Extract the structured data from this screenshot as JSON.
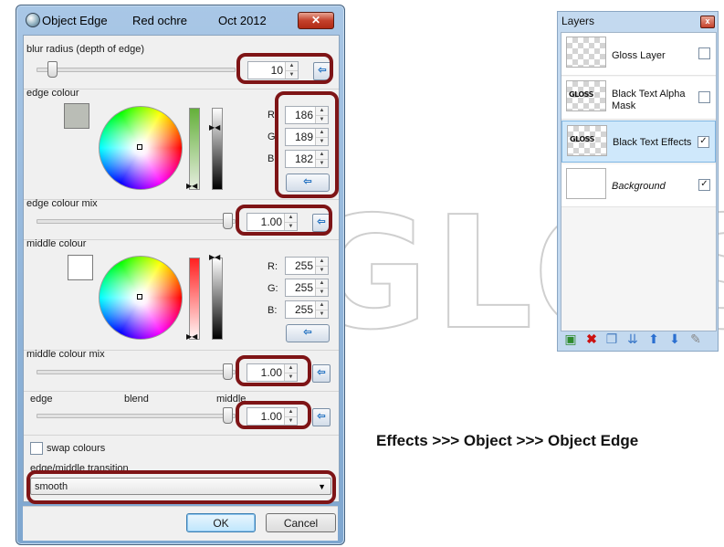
{
  "watermark": "GLOSS",
  "caption": "Effects >>> Object >>> Object Edge",
  "dialog": {
    "title": "Object Edge",
    "subtitle": "Red ochre",
    "date": "Oct 2012",
    "close_glyph": "✕",
    "blur": {
      "label": "blur radius (depth of edge)",
      "value": "10"
    },
    "edge_colour": {
      "label": "edge colour",
      "swatch": "#babdb6",
      "r_label": "R:",
      "g_label": "G:",
      "b_label": "B:",
      "r": "186",
      "g": "189",
      "b": "182"
    },
    "edge_mix": {
      "label": "edge colour mix",
      "value": "1.00"
    },
    "middle_colour": {
      "label": "middle colour",
      "swatch": "#ffffff",
      "r_label": "R:",
      "g_label": "G:",
      "b_label": "B:",
      "r": "255",
      "g": "255",
      "b": "255"
    },
    "middle_mix": {
      "label": "middle colour mix",
      "value": "1.00"
    },
    "blend": {
      "left": "edge",
      "center": "blend",
      "right": "middle",
      "value": "1.00"
    },
    "swap_label": "swap colours",
    "transition": {
      "label": "edge/middle transition",
      "selected": "smooth"
    },
    "ok": "OK",
    "cancel": "Cancel",
    "reset_glyph": "⇦"
  },
  "layers": {
    "title": "Layers",
    "close_glyph": "x",
    "items": [
      {
        "name": "Gloss Layer",
        "checked": false,
        "thumb_text": ""
      },
      {
        "name": "Black Text Alpha Mask",
        "checked": false,
        "thumb_text": "GLOSS"
      },
      {
        "name": "Black Text Effects",
        "checked": true,
        "thumb_text": "GLOSS"
      },
      {
        "name": "Background",
        "checked": true,
        "thumb_text": ""
      }
    ],
    "check_glyph": "✓"
  },
  "accent_colors": {
    "highlight_ring": "#7e1416",
    "selection": "#cfe8fb"
  }
}
